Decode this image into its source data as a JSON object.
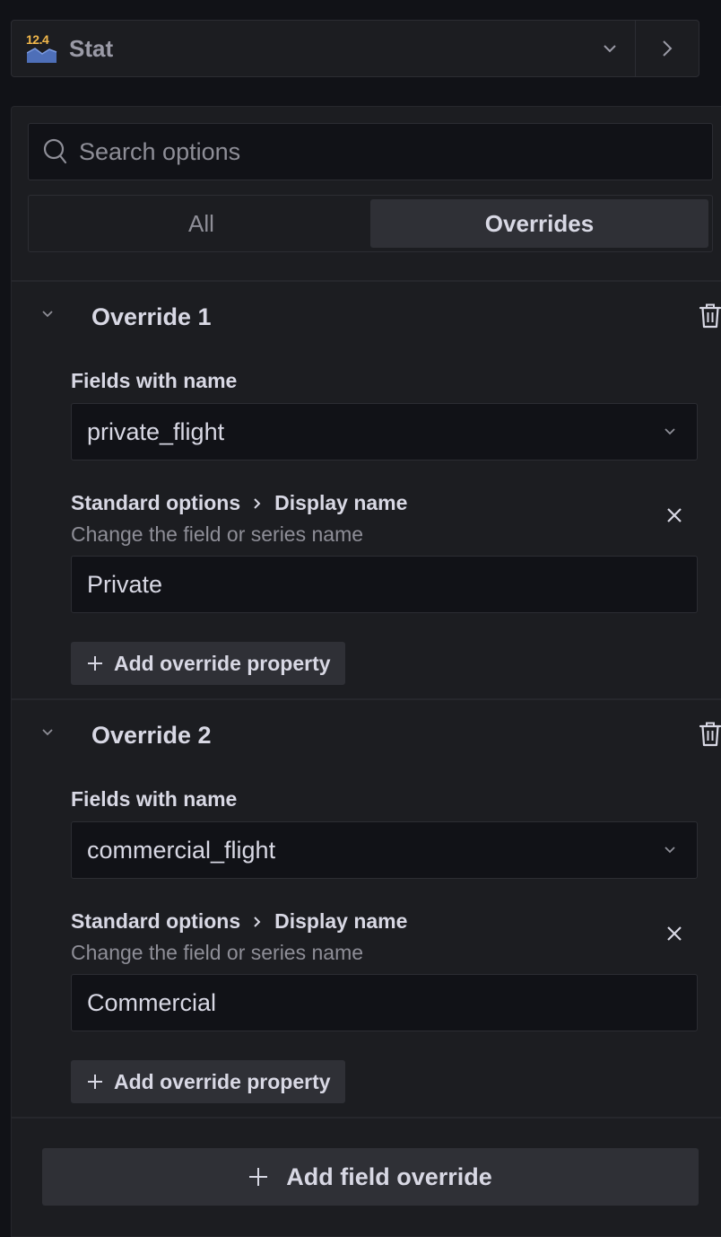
{
  "viz_picker": {
    "icon_number": "12.4",
    "name": "Stat"
  },
  "search": {
    "placeholder": "Search options",
    "value": ""
  },
  "tabs": [
    {
      "label": "All",
      "active": false
    },
    {
      "label": "Overrides",
      "active": true
    }
  ],
  "overrides": [
    {
      "title": "Override 1",
      "matcher_label": "Fields with name",
      "matcher_value": "private_flight",
      "property": {
        "category": "Standard options",
        "name": "Display name",
        "description": "Change the field or series name",
        "value": "Private"
      },
      "add_property_label": "Add override property"
    },
    {
      "title": "Override 2",
      "matcher_label": "Fields with name",
      "matcher_value": "commercial_flight",
      "property": {
        "category": "Standard options",
        "name": "Display name",
        "description": "Change the field or series name",
        "value": "Commercial"
      },
      "add_property_label": "Add override property"
    }
  ],
  "add_field_override_label": "Add field override",
  "colors": {
    "background": "#111217",
    "panel": "#1c1d21",
    "button": "#2f3036",
    "text_primary": "#d8d8e4",
    "text_secondary": "#8e8e97",
    "icon_number": "#f2b84b",
    "icon_chart": "#5b7fd0"
  }
}
